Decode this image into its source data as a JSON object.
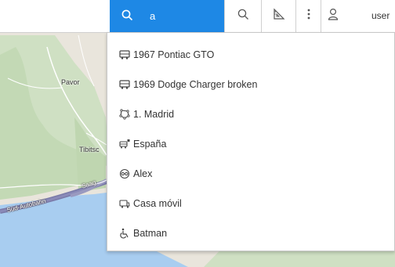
{
  "search": {
    "value": "a"
  },
  "map": {
    "labels": {
      "pavor": "Pavor",
      "tibitsc": "Tibitsc",
      "autobahn": "Süd-Autobahn",
      "saag": "Saag"
    }
  },
  "toolbar": {
    "user_label": "user"
  },
  "dropdown": {
    "items": [
      {
        "label": "1967 Pontiac GTO",
        "icon": "bus-icon"
      },
      {
        "label": "1969 Dodge Charger broken",
        "icon": "bus-icon"
      },
      {
        "label": "1. Madrid",
        "icon": "polygon-geofence-icon"
      },
      {
        "label": "España",
        "icon": "group-icon"
      },
      {
        "label": "Alex",
        "icon": "person-icon"
      },
      {
        "label": "Casa móvil",
        "icon": "camper-icon"
      },
      {
        "label": "Batman",
        "icon": "wheelchair-icon"
      }
    ]
  }
}
